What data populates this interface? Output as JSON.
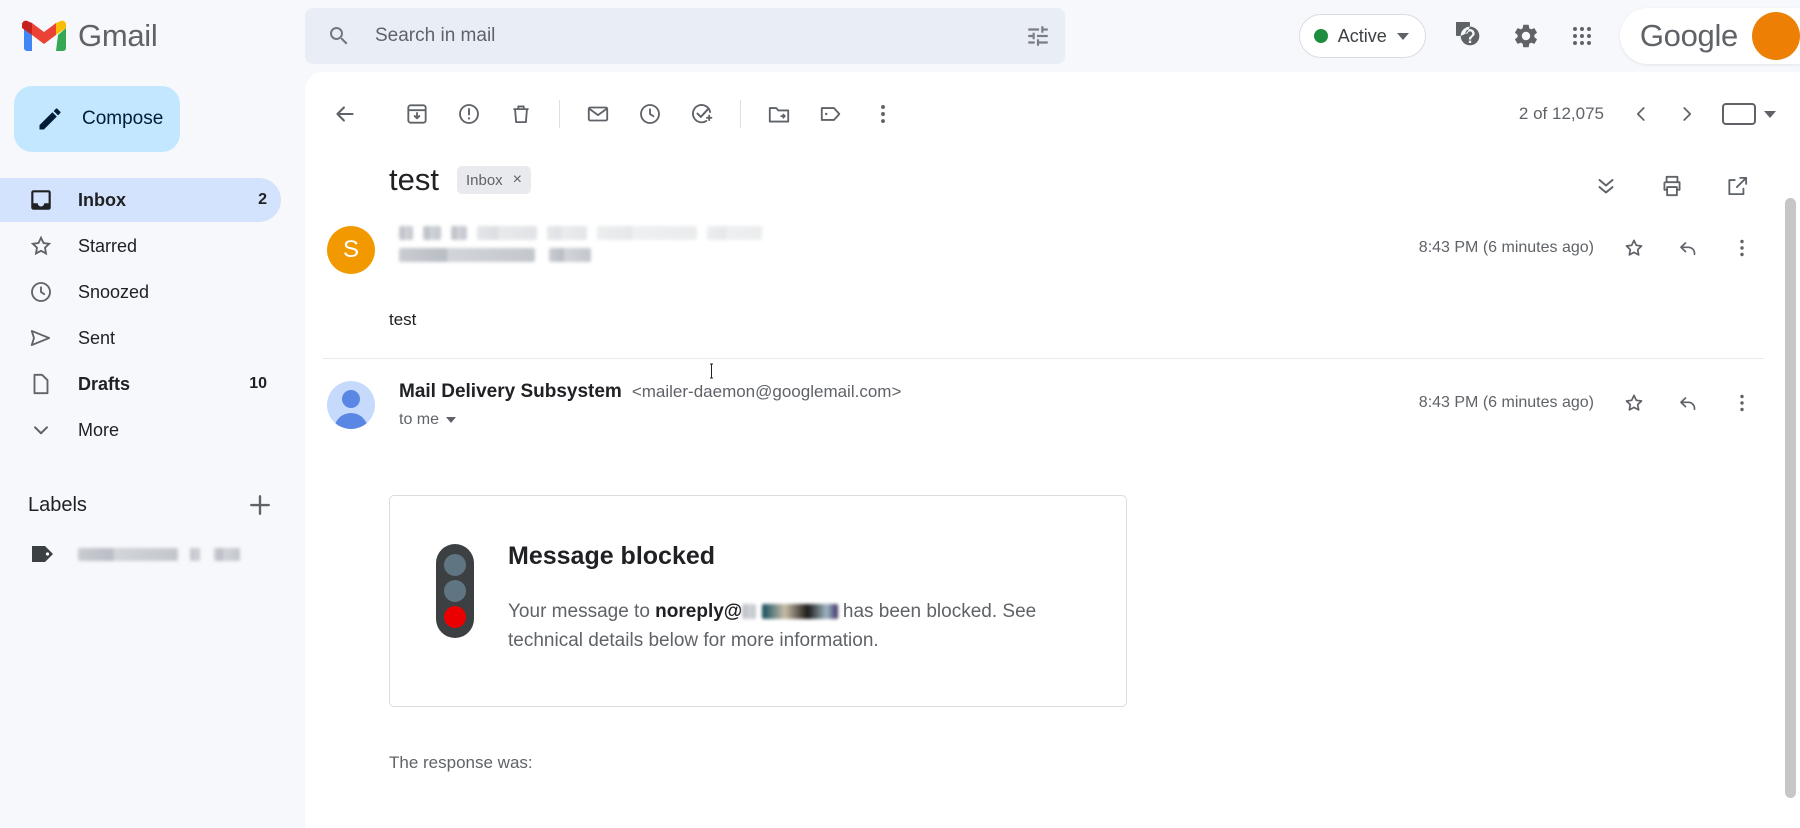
{
  "brand": {
    "name": "Gmail",
    "logo_icon": "gmail-m-logo"
  },
  "search": {
    "placeholder": "Search in mail",
    "value": "",
    "search_icon": "search-icon",
    "filter_icon": "tune-filter-icon"
  },
  "header": {
    "status_label": "Active",
    "status_color": "#1e8e3e",
    "help_icon": "help-circle-icon",
    "settings_icon": "gear-icon",
    "apps_icon": "apps-grid-icon",
    "account_word": "Google",
    "avatar_color": "#ed8004"
  },
  "sidebar": {
    "compose_label": "Compose",
    "compose_icon": "pencil-icon",
    "items": [
      {
        "label": "Inbox",
        "icon": "inbox-icon",
        "count": "2",
        "active": true,
        "bold": true
      },
      {
        "label": "Starred",
        "icon": "star-icon",
        "count": "",
        "active": false,
        "bold": false
      },
      {
        "label": "Snoozed",
        "icon": "clock-icon",
        "count": "",
        "active": false,
        "bold": false
      },
      {
        "label": "Sent",
        "icon": "send-icon",
        "count": "",
        "active": false,
        "bold": false
      },
      {
        "label": "Drafts",
        "icon": "draft-icon",
        "count": "10",
        "active": false,
        "bold": true
      },
      {
        "label": "More",
        "icon": "chevron-down-icon",
        "count": "",
        "active": false,
        "bold": false
      }
    ],
    "labels_title": "Labels",
    "add_label_icon": "plus-icon",
    "label_rows": [
      {
        "icon": "label-tag-icon",
        "redacted": true
      }
    ]
  },
  "toolbar": {
    "back_icon": "arrow-back-icon",
    "archive_icon": "archive-icon",
    "spam_icon": "report-spam-icon",
    "delete_icon": "trash-icon",
    "unread_icon": "mark-unread-icon",
    "snooze_icon": "clock-snooze-icon",
    "tasks_icon": "add-to-tasks-icon",
    "move_icon": "move-to-folder-icon",
    "label_icon": "label-tag-icon",
    "more_icon": "more-vertical-icon",
    "page_count": "2 of 12,075",
    "prev_icon": "chevron-left-icon",
    "next_icon": "chevron-right-icon",
    "keyboard_icon": "keyboard-icon",
    "keyboard_caret_icon": "chevron-down-icon"
  },
  "thread": {
    "subject": "test",
    "label_chip": "Inbox",
    "label_chip_remove": "×",
    "collapse_icon": "collapse-all-icon",
    "print_icon": "printer-icon",
    "popout_icon": "open-in-new-icon"
  },
  "messages": [
    {
      "avatar_letter": "S",
      "avatar_color": "#f29900",
      "sender_redacted": true,
      "time": "8:43 PM (6 minutes ago)",
      "star_icon": "star-outline-icon",
      "reply_icon": "reply-icon",
      "more_icon": "more-vertical-icon",
      "snippet": "test"
    },
    {
      "avatar_icon": "person-avatar-icon",
      "avatar_color": "#c6dafc",
      "sender_name": "Mail Delivery Subsystem",
      "sender_email": "<mailer-daemon@googlemail.com>",
      "to_line": "to me",
      "time": "8:43 PM (6 minutes ago)",
      "star_icon": "star-outline-icon",
      "reply_icon": "reply-icon",
      "more_icon": "more-vertical-icon"
    }
  ],
  "blocked_card": {
    "icon": "traffic-light-icon",
    "title": "Message blocked",
    "body_prefix": "Your message to ",
    "body_recipient": "noreply@",
    "body_suffix": " has been blocked. See technical details below for more information."
  },
  "footer": {
    "response_line": "The response was:"
  }
}
